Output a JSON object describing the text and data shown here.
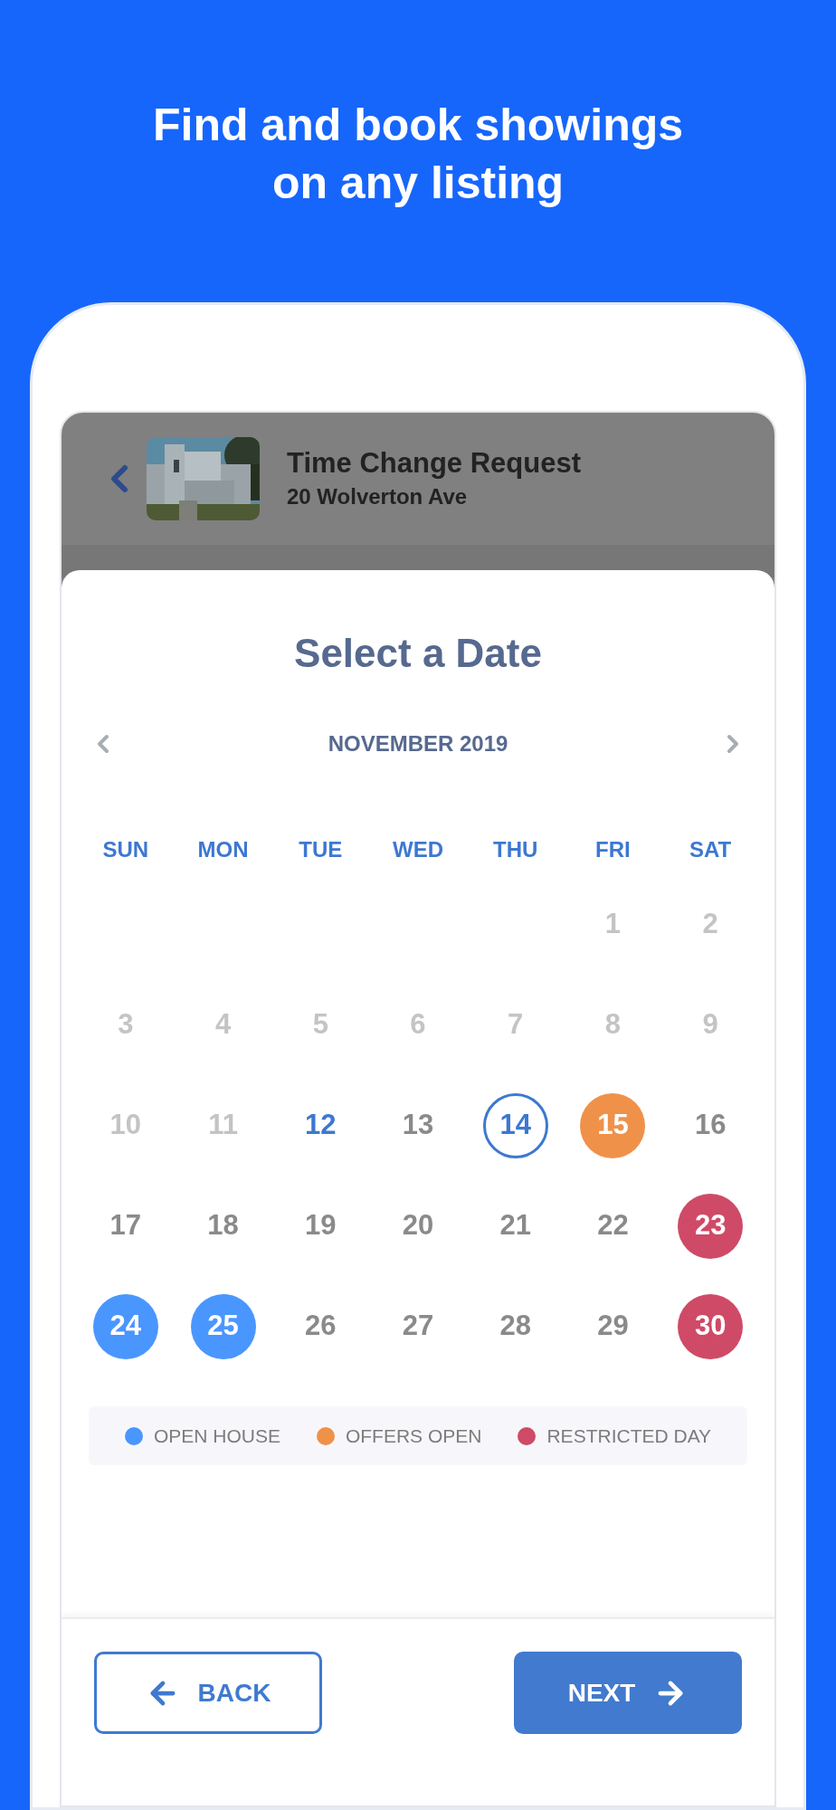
{
  "headline": [
    "Find and book showings",
    "on any listing"
  ],
  "header": {
    "title": "Time Change Request",
    "subtitle": "20 Wolverton Ave"
  },
  "sheet_title": "Select a Date",
  "month": "NOVEMBER 2019",
  "weekdays": [
    "SUN",
    "MON",
    "TUE",
    "WED",
    "THU",
    "FRI",
    "SAT"
  ],
  "weeks": [
    [
      {
        "kind": "empty"
      },
      {
        "kind": "empty"
      },
      {
        "kind": "empty"
      },
      {
        "kind": "empty"
      },
      {
        "kind": "empty"
      },
      {
        "day": "1",
        "kind": "past",
        "selected": false
      },
      {
        "day": "2",
        "kind": "past",
        "selected": false
      }
    ],
    [
      {
        "day": "3",
        "kind": "past",
        "selected": false
      },
      {
        "day": "4",
        "kind": "past",
        "selected": false
      },
      {
        "day": "5",
        "kind": "past",
        "selected": false
      },
      {
        "day": "6",
        "kind": "past",
        "selected": false
      },
      {
        "day": "7",
        "kind": "past",
        "selected": false
      },
      {
        "day": "8",
        "kind": "past",
        "selected": false
      },
      {
        "day": "9",
        "kind": "past",
        "selected": false
      }
    ],
    [
      {
        "day": "10",
        "kind": "past",
        "selected": false
      },
      {
        "day": "11",
        "kind": "past",
        "selected": false
      },
      {
        "day": "12",
        "kind": "today",
        "selected": false
      },
      {
        "day": "13",
        "kind": "available",
        "selected": false
      },
      {
        "day": "14",
        "kind": "available",
        "selected": true
      },
      {
        "day": "15",
        "kind": "event",
        "color": "#f0914a",
        "selected": false
      },
      {
        "day": "16",
        "kind": "available",
        "selected": false
      }
    ],
    [
      {
        "day": "17",
        "kind": "available",
        "selected": false
      },
      {
        "day": "18",
        "kind": "available",
        "selected": false
      },
      {
        "day": "19",
        "kind": "available",
        "selected": false
      },
      {
        "day": "20",
        "kind": "available",
        "selected": false
      },
      {
        "day": "21",
        "kind": "available",
        "selected": false
      },
      {
        "day": "22",
        "kind": "available",
        "selected": false
      },
      {
        "day": "23",
        "kind": "event",
        "color": "#cf4a66",
        "selected": false
      }
    ],
    [
      {
        "day": "24",
        "kind": "event",
        "color": "#4a96ff",
        "selected": false
      },
      {
        "day": "25",
        "kind": "event",
        "color": "#4a96ff",
        "selected": false
      },
      {
        "day": "26",
        "kind": "available",
        "selected": false
      },
      {
        "day": "27",
        "kind": "available",
        "selected": false
      },
      {
        "day": "28",
        "kind": "available",
        "selected": false
      },
      {
        "day": "29",
        "kind": "available",
        "selected": false
      },
      {
        "day": "30",
        "kind": "event",
        "color": "#cf4a66",
        "selected": false
      }
    ]
  ],
  "legend": [
    {
      "label": "OPEN HOUSE",
      "color": "#4a96ff"
    },
    {
      "label": "OFFERS OPEN",
      "color": "#f0914a"
    },
    {
      "label": "RESTRICTED DAY",
      "color": "#cf4a66"
    }
  ],
  "buttons": {
    "back": "BACK",
    "next": "NEXT"
  }
}
